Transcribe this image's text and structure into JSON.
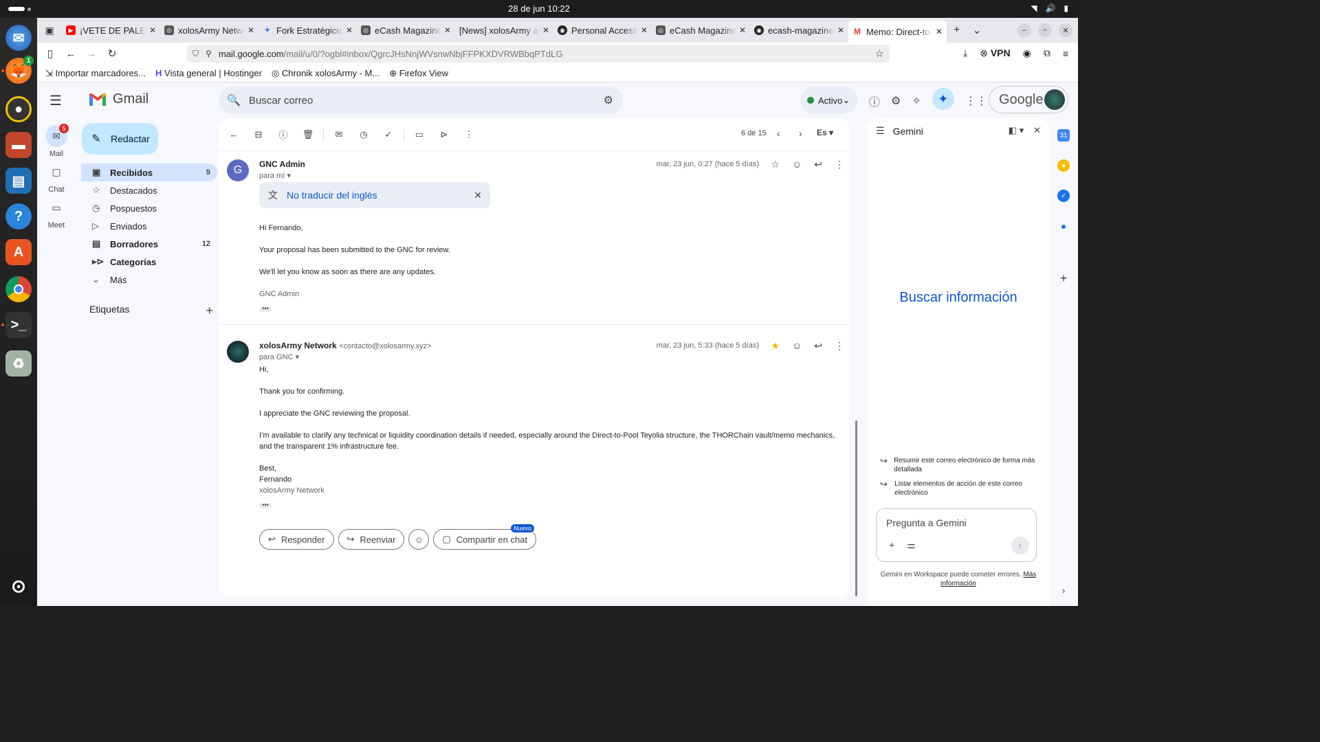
{
  "os": {
    "date": "28 de jun",
    "time": "10:22",
    "dock_badge": "1"
  },
  "tabs": [
    {
      "title": "¡VETE DE PALE",
      "icon": "youtube-icon",
      "color": "#ff0000"
    },
    {
      "title": "xolosArmy Netwo",
      "icon": "ecash-icon",
      "color": "#555555"
    },
    {
      "title": "Fork Estratégico",
      "icon": "gemini-icon",
      "color": "#4285f4"
    },
    {
      "title": "eCash Magazine",
      "icon": "ecash-icon",
      "color": "#555555"
    },
    {
      "title": "[News] xolosArmy ad",
      "icon": "blank-icon",
      "color": "#ffffff"
    },
    {
      "title": "Personal Access T",
      "icon": "github-icon",
      "color": "#222222"
    },
    {
      "title": "eCash Magazine",
      "icon": "ecash-icon",
      "color": "#555555"
    },
    {
      "title": "ecash-magazine/n",
      "icon": "github-icon",
      "color": "#222222"
    },
    {
      "title": "Memo: Direct-to-P",
      "icon": "gmail-icon",
      "color": "#ea4335"
    }
  ],
  "url": {
    "domain": "mail.google.com",
    "path": "/mail/u/0/?ogbl#inbox/QgrcJHsNnjWVsnwNbjFFPKXDVRWBbqPTdLG"
  },
  "browser_right": {
    "vpn": "VPN"
  },
  "bookmarks": [
    "Importar marcadores...",
    "Vista general | Hostinger",
    "Chronik xolosArmy - M...",
    "Firefox View"
  ],
  "gmail": {
    "app_name": "Gmail",
    "search_placeholder": "Buscar correo",
    "status": "Activo",
    "account": "Google",
    "compose": "Redactar",
    "rail": [
      {
        "label": "Mail",
        "badge": "5"
      },
      {
        "label": "Chat"
      },
      {
        "label": "Meet"
      }
    ],
    "folders": [
      {
        "label": "Recibidos",
        "count": "5"
      },
      {
        "label": "Destacados",
        "count": ""
      },
      {
        "label": "Pospuestos",
        "count": ""
      },
      {
        "label": "Enviados",
        "count": ""
      },
      {
        "label": "Borradores",
        "count": "12"
      },
      {
        "label": "Categorías",
        "count": ""
      },
      {
        "label": "Más",
        "count": ""
      }
    ],
    "labels_title": "Etiquetas",
    "pager": "6 de 15",
    "lang_btn": "Es"
  },
  "messages": [
    {
      "avatar": "G",
      "sender": "GNC Admin",
      "email": "",
      "to": "para mí",
      "date": "mar, 23 jun, 0:27 (hace 5 días)",
      "translate": "No traducir del inglés",
      "body": [
        "Hi Fernando,",
        "Your proposal has been submitted to the GNC for review.",
        "We'll let you know as soon as there are any updates."
      ],
      "signature": "GNC Admin"
    },
    {
      "sender": "xolosArmy Network",
      "email": "<contacto@xolosarmy.xyz>",
      "to": "para GNC",
      "date": "mar, 23 jun, 5:33 (hace 5 días)",
      "body": [
        "Hi,",
        "Thank you for confirming.",
        "I appreciate the GNC reviewing the proposal.",
        "I’m available to clarify any technical or liquidity coordination details if needed, especially around the Direct-to-Pool Teyolia structure, the THORChain vault/memo mechanics, and the transparent 1% infrastructure fee."
      ],
      "closing": [
        "Best,",
        "Fernando"
      ],
      "signature": "xolosArmy Network"
    }
  ],
  "actions": {
    "reply": "Responder",
    "forward": "Reenviar",
    "share": "Compartir en chat",
    "new_badge": "Nuevo"
  },
  "gemini": {
    "title": "Gemini",
    "hero": "Buscar información",
    "suggestions": [
      "Resumir este correo electrónico de forma más detallada",
      "Listar elementos de acción de este correo electrónico"
    ],
    "input_placeholder": "Pregunta a Gemini",
    "footer": "Gemini en Workspace puede cometer errores.",
    "footer_link": "Más información"
  }
}
